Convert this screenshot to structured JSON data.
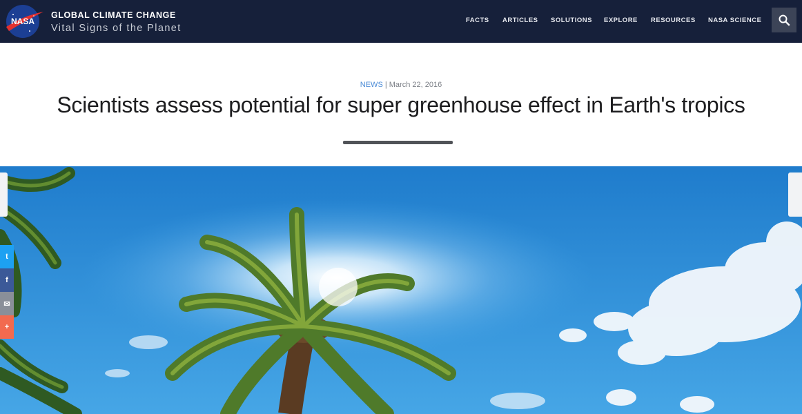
{
  "header": {
    "logo_text": "NASA",
    "title": "GLOBAL CLIMATE CHANGE",
    "subtitle": "Vital Signs of the Planet",
    "nav": [
      {
        "label": "FACTS"
      },
      {
        "label": "ARTICLES"
      },
      {
        "label": "SOLUTIONS"
      },
      {
        "label": "EXPLORE"
      },
      {
        "label": "RESOURCES"
      },
      {
        "label": "NASA SCIENCE"
      }
    ],
    "search_icon": "search-icon"
  },
  "article": {
    "category": "NEWS",
    "separator": "|",
    "date": "March 22, 2016",
    "headline": "Scientists assess potential for super greenhouse effect in Earth's tropics"
  },
  "share": {
    "buttons": [
      {
        "icon": "twitter-icon",
        "glyph": "t",
        "color": "#1da1f2"
      },
      {
        "icon": "facebook-icon",
        "glyph": "f",
        "color": "#3b5998"
      },
      {
        "icon": "email-icon",
        "glyph": "✉",
        "color": "#8a8f99"
      },
      {
        "icon": "more-icon",
        "glyph": "+",
        "color": "#f26a4f"
      }
    ]
  },
  "colors": {
    "header_bg": "#16203a",
    "accent": "#4b8bd6",
    "headline": "#1d1d1f",
    "sky": "#2f8fd8"
  }
}
